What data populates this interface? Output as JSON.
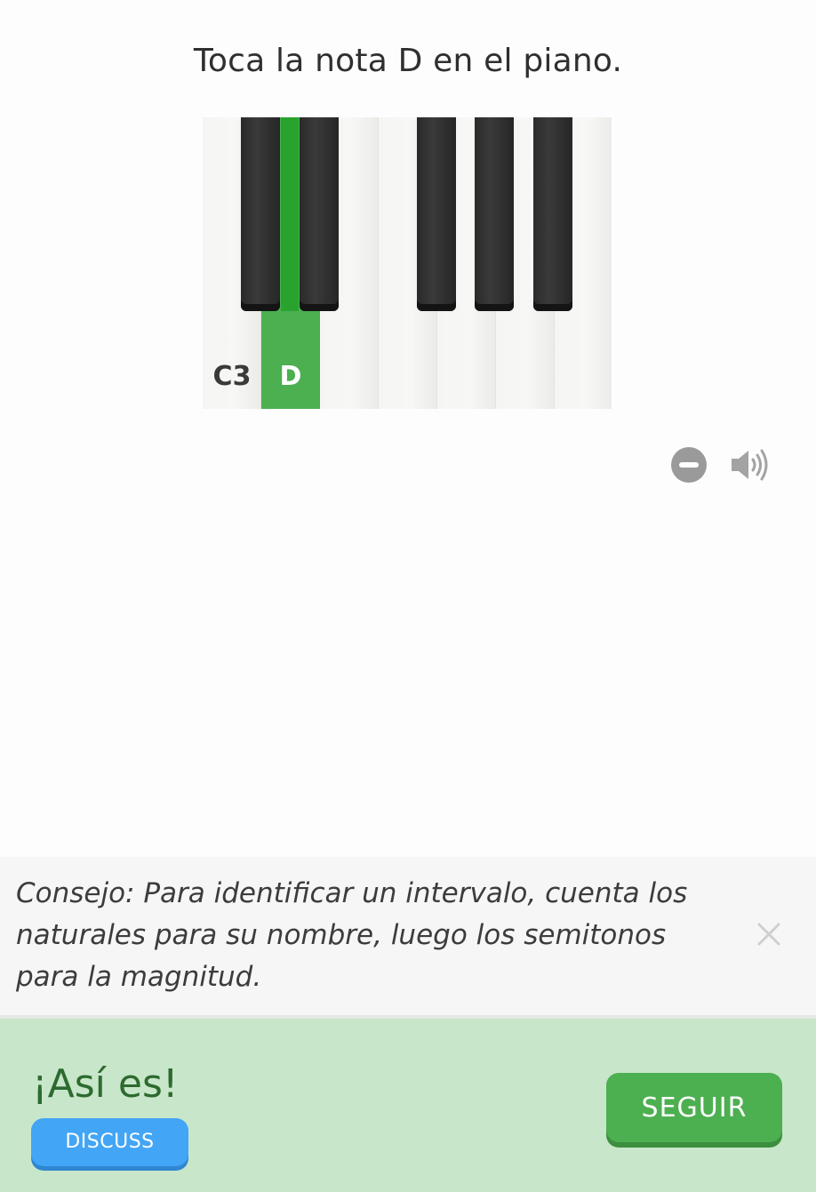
{
  "exercise": {
    "prompt": "Toca la nota D en el piano."
  },
  "piano": {
    "highlight_color": "#4caf50",
    "key_labels": {
      "c3": "C3",
      "d": "D"
    },
    "highlighted_key": "D"
  },
  "controls": {
    "remove_icon": "minus-circle-icon",
    "audio_icon": "speaker-icon"
  },
  "tip": {
    "text": "Consejo: Para identificar un intervalo, cuenta los naturales para su nombre, luego los semitonos para la magnitud.",
    "close_icon": "close-icon"
  },
  "result": {
    "title": "¡Así es!",
    "discuss_label": "DISCUSS",
    "continue_label": "SEGUIR",
    "bar_color": "#c8e6c9",
    "continue_color": "#4caf50",
    "discuss_color": "#42a5f5"
  }
}
